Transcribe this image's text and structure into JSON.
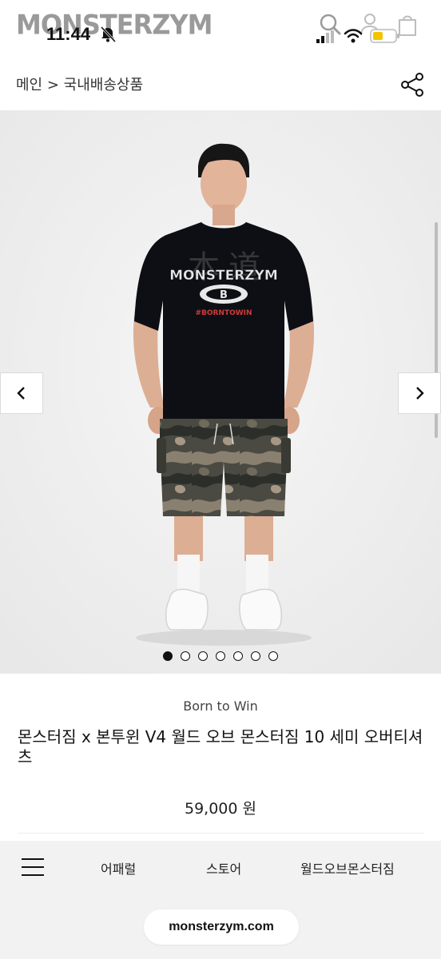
{
  "status": {
    "brand_logo": "MONSTERZYM",
    "time": "11:44"
  },
  "breadcrumb": {
    "text": "메인 > 국내배송상품"
  },
  "gallery": {
    "total_images": 7,
    "active_index": 0,
    "tshirt_print": {
      "logo": "MONSTERZYM",
      "tagline": "#BORNTOWIN",
      "badge": "B"
    }
  },
  "product": {
    "brand": "Born to Win",
    "title": "몬스터짐 x 본투윈 V4 월드 오브 몬스터짐 10 세미 오버티셔츠",
    "price": "59,000 원"
  },
  "bottom_nav": {
    "items": [
      "어패럴",
      "스토어",
      "월드오브몬스터짐"
    ]
  },
  "browser": {
    "url": "monsterzym.com"
  },
  "colors": {
    "background": "#ffffff",
    "gallery_bg": "#f0f0f0",
    "bottom_bg": "#f2f2f2",
    "text": "#111111",
    "battery_accent": "#f5c400"
  }
}
